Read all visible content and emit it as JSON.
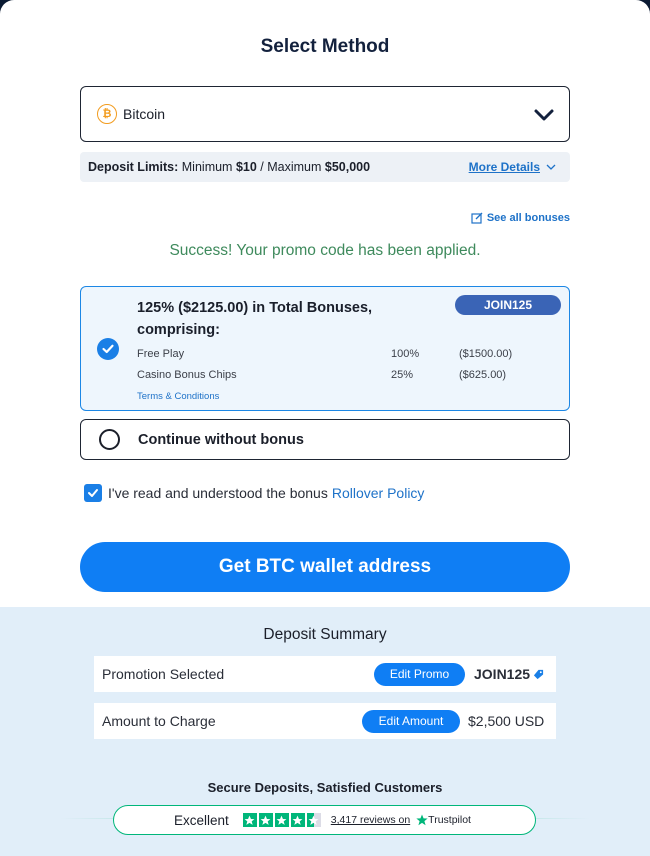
{
  "header": {
    "title": "Select Method"
  },
  "method_select": {
    "value": "Bitcoin",
    "icon": "bitcoin-icon"
  },
  "limits": {
    "label": "Deposit Limits:",
    "min_label": " Minimum ",
    "min_value": "$10",
    "sep": " / Maximum ",
    "max_value": "$50,000",
    "more_details": "More Details"
  },
  "see_all_bonuses": "See all bonuses",
  "success_message": "Success! Your promo code has been applied.",
  "bonus": {
    "title": "125% ($2125.00) in Total Bonuses, comprising:",
    "promo_code": "JOIN125",
    "rows": [
      {
        "name": "Free Play",
        "pct": "100%",
        "amount": "($1500.00)"
      },
      {
        "name": "Casino Bonus Chips",
        "pct": "25%",
        "amount": "($625.00)"
      }
    ],
    "terms": "Terms & Conditions",
    "selected": true
  },
  "no_bonus": {
    "label": "Continue without bonus"
  },
  "acknowledge": {
    "text": "I've read and understood the bonus",
    "link": "Rollover Policy",
    "checked": true
  },
  "cta": {
    "label": "Get BTC wallet address"
  },
  "summary": {
    "title": "Deposit Summary",
    "promotion": {
      "label": "Promotion Selected",
      "button": "Edit Promo",
      "value": "JOIN125"
    },
    "amount": {
      "label": "Amount to Charge",
      "button": "Edit Amount",
      "value": "$2,500 USD"
    }
  },
  "trust": {
    "heading": "Secure Deposits, Satisfied Customers",
    "rating_word": "Excellent",
    "stars": 4.5,
    "reviews": "3,417 reviews on",
    "brand": "Trustpilot"
  },
  "colors": {
    "accent": "#0f7ef4",
    "promo_pill": "#3a64b6",
    "success": "#3e8a5c",
    "trustpilot": "#00b67a"
  }
}
